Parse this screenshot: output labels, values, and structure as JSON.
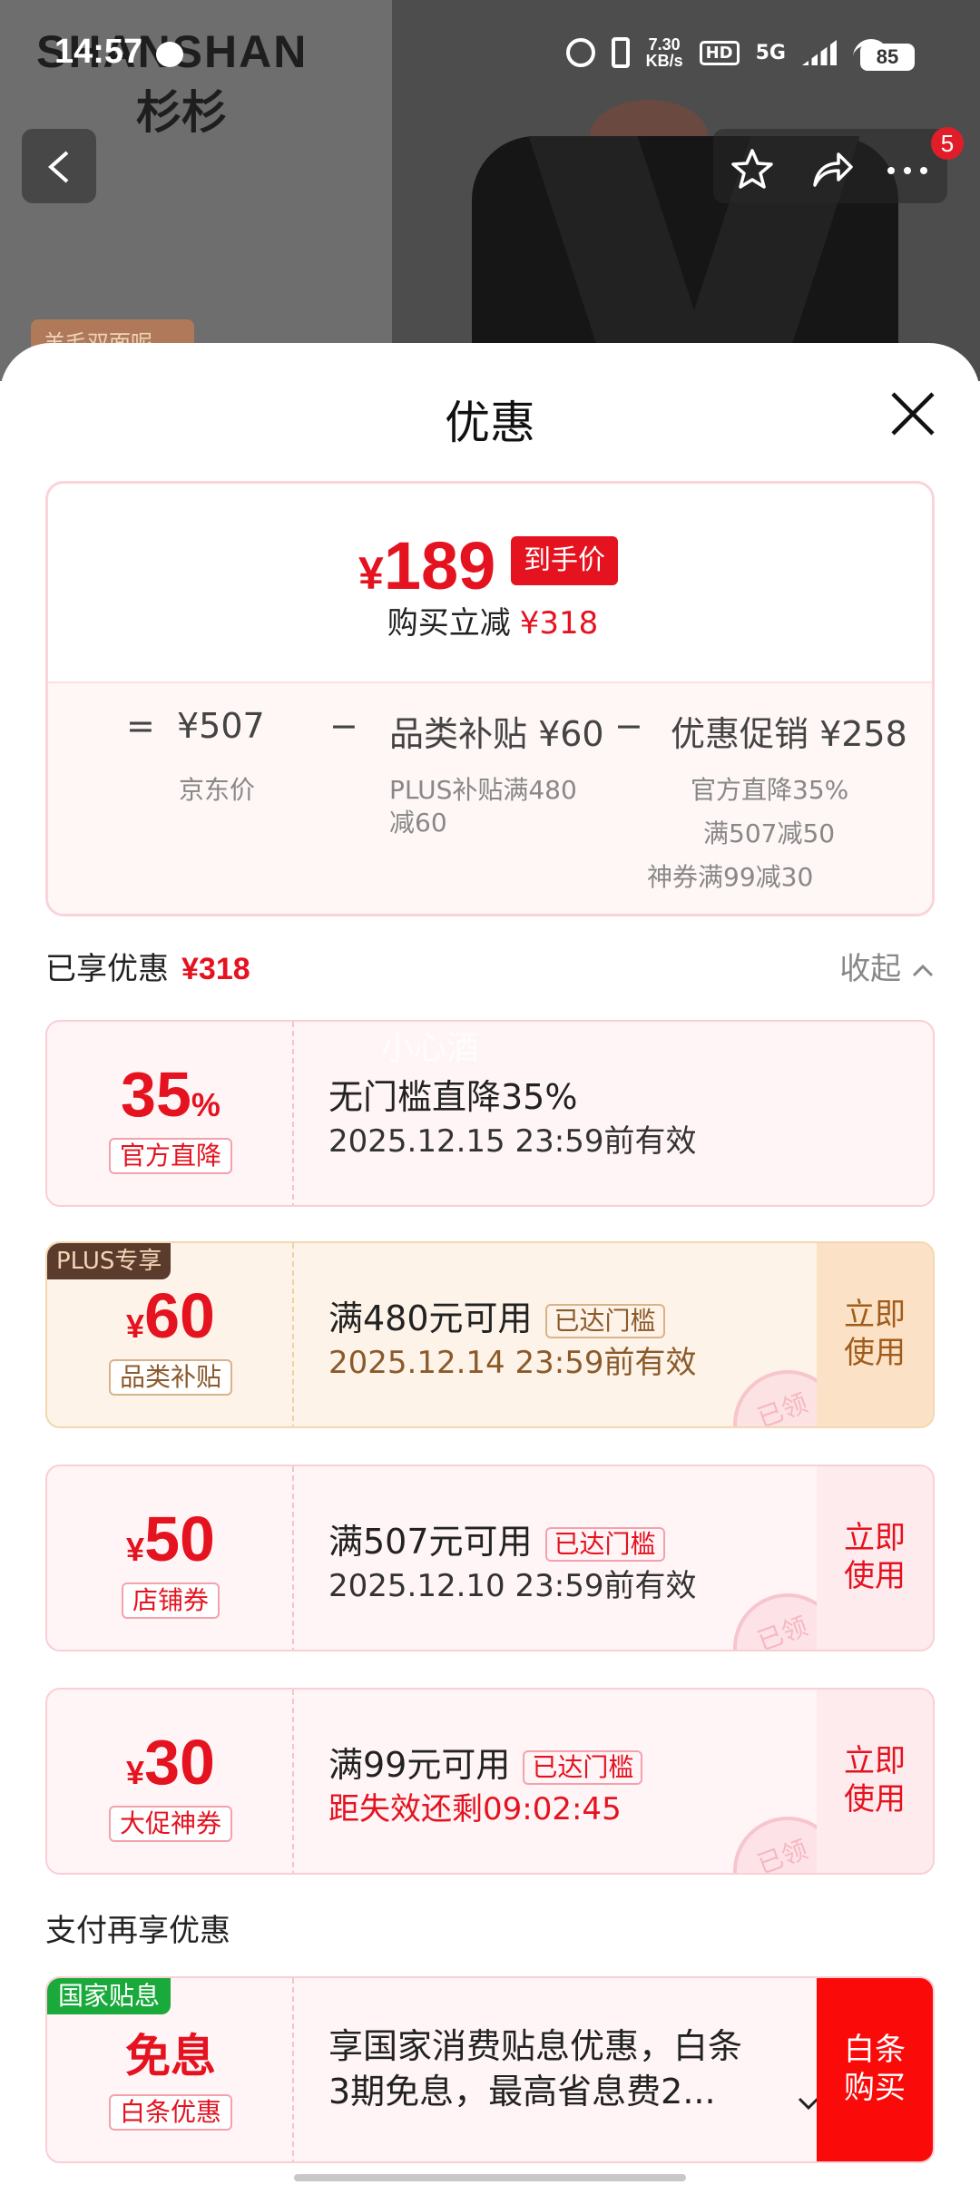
{
  "status_bar": {
    "time": "14:57",
    "speed_value": "7.30",
    "speed_unit": "KB/s",
    "hd": "HD",
    "network": "5G",
    "battery": "85"
  },
  "background": {
    "brand": "SHANSHAN",
    "brand_cn": "杉杉",
    "product_tag": "羊毛双面呢",
    "cart_badge": "5"
  },
  "sheet": {
    "title": "优惠",
    "summary": {
      "currency": "¥",
      "final_price": "189",
      "final_tag": "到手价",
      "save_label": "购买立减",
      "save_amount": "¥318",
      "formula": {
        "eq": "=",
        "jd_price": "¥507",
        "minus1": "−",
        "subsidy": "品类补贴 ¥60",
        "minus2": "−",
        "promo": "优惠促销 ¥258",
        "jd_price_label": "京东价",
        "subsidy_note_1": "PLUS补贴满480",
        "subsidy_note_2": "减60",
        "promo_note_1": "官方直降35%",
        "promo_note_2": "满507减50",
        "promo_note_3": "神券满99减30"
      }
    },
    "enjoyed": {
      "label": "已享优惠",
      "amount": "¥318",
      "collapse": "收起"
    },
    "watermark": "小心酒",
    "coupons": [
      {
        "amount": "35",
        "unit": "%",
        "tag": "官方直降",
        "title": "无门槛直降35%",
        "sub": "2025.12.15 23:59前有效"
      },
      {
        "badge": "PLUS专享",
        "currency": "¥",
        "amount": "60",
        "tag": "品类补贴",
        "title": "满480元可用",
        "reached": "已达门槛",
        "sub": "2025.12.14 23:59前有效",
        "use_1": "立即",
        "use_2": "使用",
        "stamp": "已领"
      },
      {
        "currency": "¥",
        "amount": "50",
        "tag": "店铺券",
        "title": "满507元可用",
        "reached": "已达门槛",
        "sub": "2025.12.10 23:59前有效",
        "use_1": "立即",
        "use_2": "使用",
        "stamp": "已领"
      },
      {
        "currency": "¥",
        "amount": "30",
        "tag": "大促神券",
        "title": "满99元可用",
        "reached": "已达门槛",
        "sub": "距失效还剩09:02:45",
        "use_1": "立即",
        "use_2": "使用",
        "stamp": "已领"
      }
    ],
    "pay_section": {
      "label": "支付再享优惠",
      "badge": "国家贴息",
      "amount": "免息",
      "tag": "白条优惠",
      "text_1": "享国家消费贴息优惠，白条",
      "text_2": "3期免息，最高省息费2...",
      "btn_1": "白条",
      "btn_2": "购买"
    }
  },
  "colors": {
    "accent_red": "#e5121f",
    "gold_bg": "#fdf3e8",
    "pink_bg": "#fff5f6",
    "green_badge": "#1aaa3c"
  }
}
